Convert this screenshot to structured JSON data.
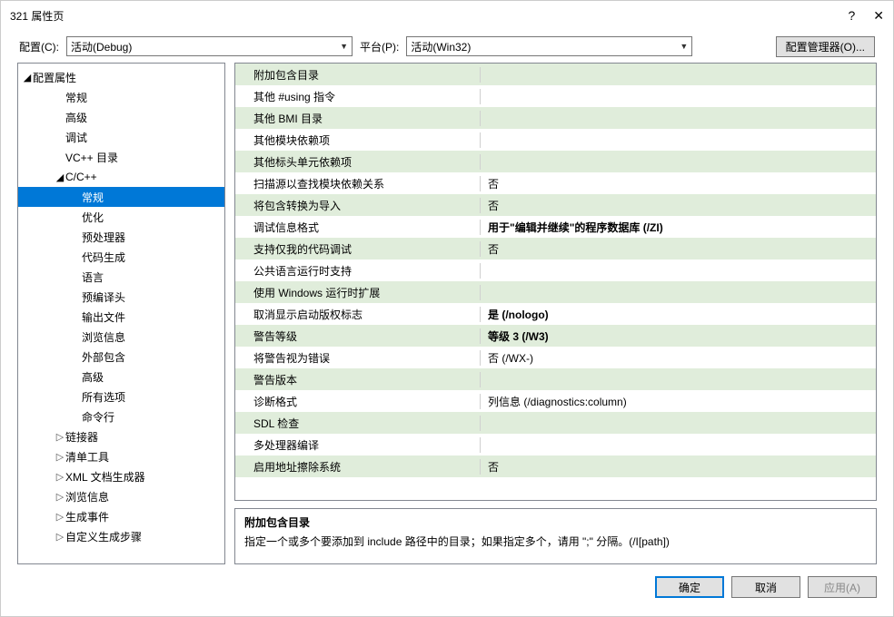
{
  "window": {
    "title": "321 属性页"
  },
  "toolbar": {
    "config_label": "配置(C):",
    "config_value": "活动(Debug)",
    "platform_label": "平台(P):",
    "platform_value": "活动(Win32)",
    "config_mgr_btn": "配置管理器(O)..."
  },
  "tree": {
    "root": "配置属性",
    "items": [
      {
        "label": "常规",
        "indent": 2
      },
      {
        "label": "高级",
        "indent": 2
      },
      {
        "label": "调试",
        "indent": 2
      },
      {
        "label": "VC++ 目录",
        "indent": 2
      },
      {
        "label": "C/C++",
        "indent": 2,
        "expandable": true,
        "open": true
      },
      {
        "label": "常规",
        "indent": 3,
        "selected": true
      },
      {
        "label": "优化",
        "indent": 3
      },
      {
        "label": "预处理器",
        "indent": 3
      },
      {
        "label": "代码生成",
        "indent": 3
      },
      {
        "label": "语言",
        "indent": 3
      },
      {
        "label": "预编译头",
        "indent": 3
      },
      {
        "label": "输出文件",
        "indent": 3
      },
      {
        "label": "浏览信息",
        "indent": 3
      },
      {
        "label": "外部包含",
        "indent": 3
      },
      {
        "label": "高级",
        "indent": 3
      },
      {
        "label": "所有选项",
        "indent": 3
      },
      {
        "label": "命令行",
        "indent": 3
      },
      {
        "label": "链接器",
        "indent": 2,
        "expandable": true
      },
      {
        "label": "清单工具",
        "indent": 2,
        "expandable": true
      },
      {
        "label": "XML 文档生成器",
        "indent": 2,
        "expandable": true
      },
      {
        "label": "浏览信息",
        "indent": 2,
        "expandable": true
      },
      {
        "label": "生成事件",
        "indent": 2,
        "expandable": true
      },
      {
        "label": "自定义生成步骤",
        "indent": 2,
        "expandable": true
      }
    ]
  },
  "grid": [
    {
      "label": "附加包含目录",
      "value": ""
    },
    {
      "label": "其他 #using 指令",
      "value": ""
    },
    {
      "label": "其他 BMI 目录",
      "value": ""
    },
    {
      "label": "其他模块依赖项",
      "value": ""
    },
    {
      "label": "其他标头单元依赖项",
      "value": ""
    },
    {
      "label": "扫描源以查找模块依赖关系",
      "value": "否"
    },
    {
      "label": "将包含转换为导入",
      "value": "否"
    },
    {
      "label": "调试信息格式",
      "value": "用于\"编辑并继续\"的程序数据库 (/ZI)",
      "bold": true
    },
    {
      "label": "支持仅我的代码调试",
      "value": "否"
    },
    {
      "label": "公共语言运行时支持",
      "value": ""
    },
    {
      "label": "使用 Windows 运行时扩展",
      "value": ""
    },
    {
      "label": "取消显示启动版权标志",
      "value": "是 (/nologo)",
      "bold": true
    },
    {
      "label": "警告等级",
      "value": "等级 3 (/W3)",
      "bold": true
    },
    {
      "label": "将警告视为错误",
      "value": "否 (/WX-)"
    },
    {
      "label": "警告版本",
      "value": ""
    },
    {
      "label": "诊断格式",
      "value": "列信息 (/diagnostics:column)"
    },
    {
      "label": "SDL 检查",
      "value": ""
    },
    {
      "label": "多处理器编译",
      "value": ""
    },
    {
      "label": "启用地址擦除系统",
      "value": "否"
    }
  ],
  "desc": {
    "title": "附加包含目录",
    "body": "指定一个或多个要添加到 include 路径中的目录；如果指定多个，请用 \";\" 分隔。(/I[path])"
  },
  "footer": {
    "ok": "确定",
    "cancel": "取消",
    "apply": "应用(A)"
  }
}
